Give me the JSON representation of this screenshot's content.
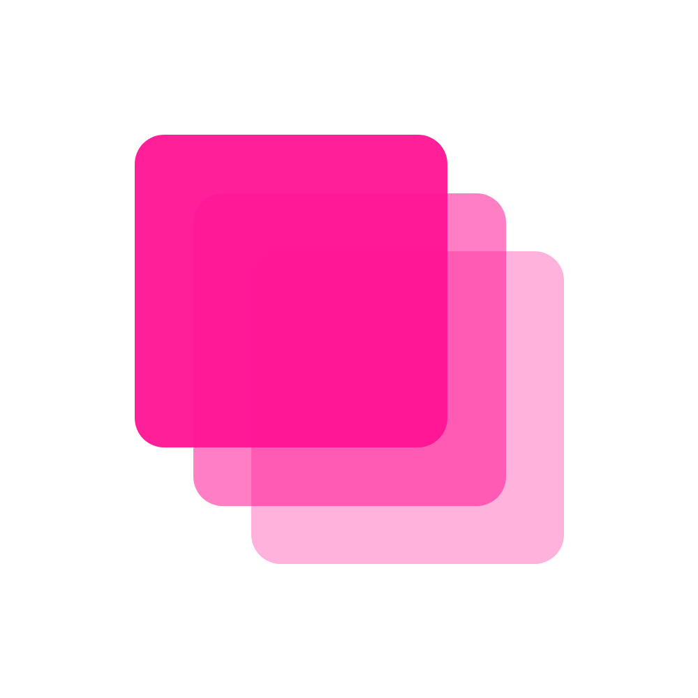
{
  "icon": {
    "name": "stacked-layers-icon",
    "layers": [
      {
        "name": "back-layer",
        "color": "#ff1493",
        "opacity": 0.33
      },
      {
        "name": "middle-layer",
        "color": "#ff1493",
        "opacity": 0.55
      },
      {
        "name": "front-layer",
        "color": "#ff1493",
        "opacity": 0.95
      }
    ]
  }
}
